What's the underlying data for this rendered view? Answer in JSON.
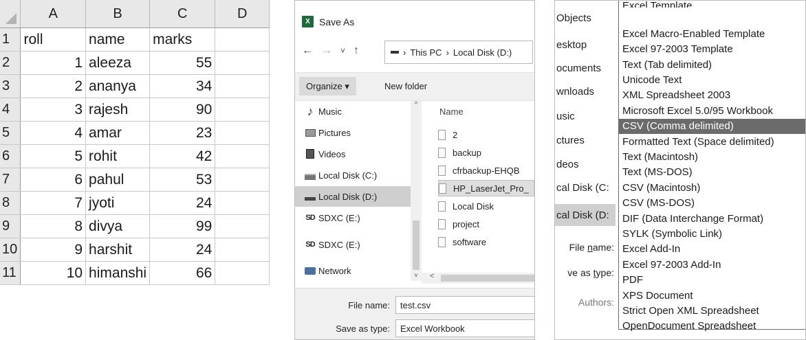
{
  "spreadsheet": {
    "columns": [
      "A",
      "B",
      "C",
      "D"
    ],
    "rows": [
      {
        "n": "1",
        "a": "roll",
        "b": "name",
        "c": "marks",
        "d": ""
      },
      {
        "n": "2",
        "a": "1",
        "b": "aleeza",
        "c": "55",
        "d": ""
      },
      {
        "n": "3",
        "a": "2",
        "b": "ananya",
        "c": "34",
        "d": ""
      },
      {
        "n": "4",
        "a": "3",
        "b": "rajesh",
        "c": "90",
        "d": ""
      },
      {
        "n": "5",
        "a": "4",
        "b": "amar",
        "c": "23",
        "d": ""
      },
      {
        "n": "6",
        "a": "5",
        "b": "rohit",
        "c": "42",
        "d": ""
      },
      {
        "n": "7",
        "a": "6",
        "b": "pahul",
        "c": "53",
        "d": ""
      },
      {
        "n": "8",
        "a": "7",
        "b": "jyoti",
        "c": "24",
        "d": ""
      },
      {
        "n": "9",
        "a": "8",
        "b": "divya",
        "c": "99",
        "d": ""
      },
      {
        "n": "10",
        "a": "9",
        "b": "harshit",
        "c": "24",
        "d": ""
      },
      {
        "n": "11",
        "a": "10",
        "b": "himanshi",
        "c": "66",
        "d": ""
      }
    ]
  },
  "save_dialog": {
    "title": "Save As",
    "app_icon": "X",
    "nav": {
      "back": "←",
      "forward": "→",
      "recent": "˅",
      "up": "↑"
    },
    "address": {
      "separator": "›",
      "crumbs": [
        "This PC",
        "Local Disk (D:)"
      ]
    },
    "toolbar": {
      "organize": "Organize ▾",
      "new_folder": "New folder"
    },
    "nav_pane": [
      {
        "label": "Music",
        "icon": "music-icon",
        "selected": false
      },
      {
        "label": "Pictures",
        "icon": "pictures-icon",
        "selected": false
      },
      {
        "label": "Videos",
        "icon": "videos-icon",
        "selected": false
      },
      {
        "label": "Local Disk (C:)",
        "icon": "drive-icon",
        "selected": false
      },
      {
        "label": "Local Disk (D:)",
        "icon": "drive-icon",
        "selected": true
      },
      {
        "label": "SDXC (E:)",
        "icon": "sd-card-icon",
        "selected": false
      },
      {
        "label": "SDXC (E:)",
        "icon": "sd-card-icon",
        "selected": false
      },
      {
        "label": "Network",
        "icon": "network-icon",
        "selected": false
      }
    ],
    "scroll": {
      "up": "^",
      "down": "˅",
      "left": "<"
    },
    "files_header": "Name",
    "files": [
      {
        "name": "2",
        "selected": false
      },
      {
        "name": "backup",
        "selected": false
      },
      {
        "name": "cfrbackup-EHQB",
        "selected": false
      },
      {
        "name": "HP_LaserJet_Pro_",
        "selected": true
      },
      {
        "name": "Local Disk",
        "selected": false
      },
      {
        "name": "project",
        "selected": false
      },
      {
        "name": "software",
        "selected": false
      }
    ],
    "file_name_label": "File name:",
    "file_name_value": "test.csv",
    "save_type_label": "Save as type:",
    "save_type_value": "Excel Workbook"
  },
  "type_dropdown": {
    "side_items": [
      {
        "label": "Objects",
        "selected": false
      },
      {
        "label": "esktop",
        "selected": false
      },
      {
        "label": "ocuments",
        "selected": false
      },
      {
        "label": "wnloads",
        "selected": false
      },
      {
        "label": "usic",
        "selected": false
      },
      {
        "label": "ctures",
        "selected": false
      },
      {
        "label": "deos",
        "selected": false
      },
      {
        "label": "cal Disk (C:",
        "selected": false
      },
      {
        "label": "cal Disk (D:",
        "selected": true
      }
    ],
    "file_name_label_pre": "File ",
    "file_name_label_u": "n",
    "file_name_label_post": "ame:",
    "save_type_label_pre": "ve as ",
    "save_type_label_u": "t",
    "save_type_label_post": "ype:",
    "authors_label": "Authors:",
    "options": [
      "Excel Template",
      "Excel Macro-Enabled Template",
      "Excel 97-2003 Template",
      "Text (Tab delimited)",
      "Unicode Text",
      "XML Spreadsheet 2003",
      "Microsoft Excel 5.0/95 Workbook",
      "CSV (Comma delimited)",
      "Formatted Text (Space delimited)",
      "Text (Macintosh)",
      "Text (MS-DOS)",
      "CSV (Macintosh)",
      "CSV (MS-DOS)",
      "DIF (Data Interchange Format)",
      "SYLK (Symbolic Link)",
      "Excel Add-In",
      "Excel 97-2003 Add-In",
      "PDF",
      "XPS Document",
      "Strict Open XML Spreadsheet",
      "OpenDocument Spreadsheet"
    ],
    "selected_index": 7
  }
}
